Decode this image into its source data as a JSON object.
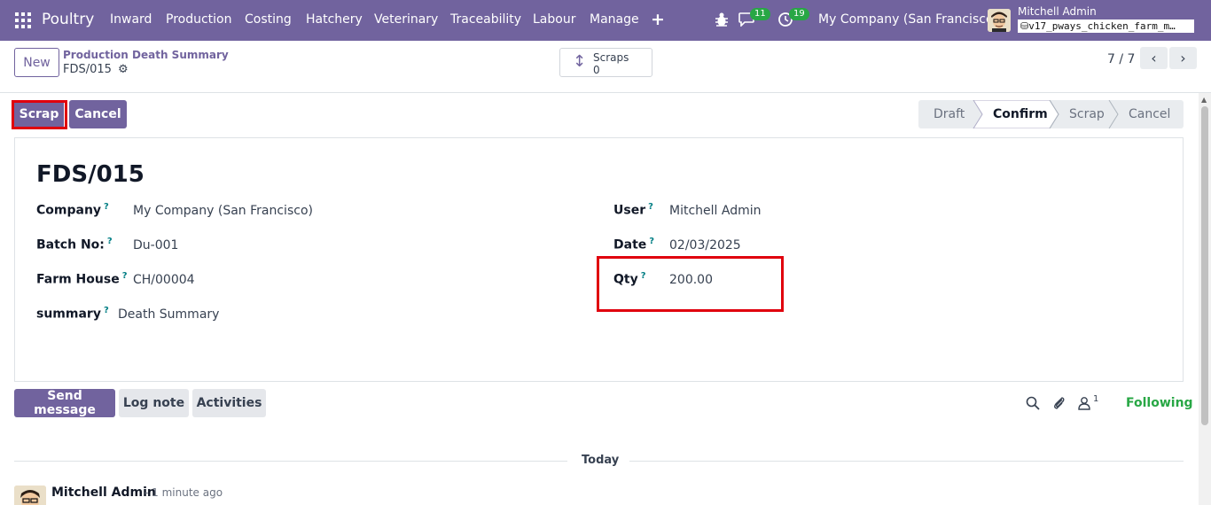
{
  "navbar": {
    "brand": "Poultry",
    "menu": [
      "Inward",
      "Production",
      "Costing",
      "Hatchery",
      "Veterinary",
      "Traceability",
      "Labour",
      "Manage"
    ],
    "chat_count": "11",
    "activity_count": "19",
    "company": "My Company (San Francisco)",
    "user_name": "Mitchell Admin",
    "database": "v17_pways_chicken_farm_m…"
  },
  "control": {
    "new_label": "New",
    "breadcrumb": "Production Death Summary",
    "record_name": "FDS/015",
    "smart_button": {
      "label": "Scraps",
      "value": "0"
    },
    "pager": "7 / 7"
  },
  "actions": {
    "scrap_label": "Scrap",
    "cancel_label": "Cancel"
  },
  "status_stages": [
    "Draft",
    "Confirm",
    "Scrap",
    "Cancel"
  ],
  "active_stage": "Confirm",
  "form": {
    "title": "FDS/015",
    "company_label": "Company",
    "company_value": "My Company (San Francisco)",
    "batch_label": "Batch No:",
    "batch_value": "Du-001",
    "farm_label": "Farm House",
    "farm_value": "CH/00004",
    "summary_label": "summary",
    "summary_value": "Death Summary",
    "user_label": "User",
    "user_value": "Mitchell Admin",
    "date_label": "Date",
    "date_value": "02/03/2025",
    "qty_label": "Qty",
    "qty_value": "200.00",
    "help_mark": "?"
  },
  "chatter": {
    "send_message": "Send message",
    "log_note": "Log note",
    "activities": "Activities",
    "followers_count": "1",
    "following": "Following",
    "today": "Today",
    "author": "Mitchell Admin",
    "time": "- 1 minute ago"
  },
  "colors": {
    "brand": "#71639e",
    "highlight": "#e0000d",
    "success": "#28a745"
  }
}
